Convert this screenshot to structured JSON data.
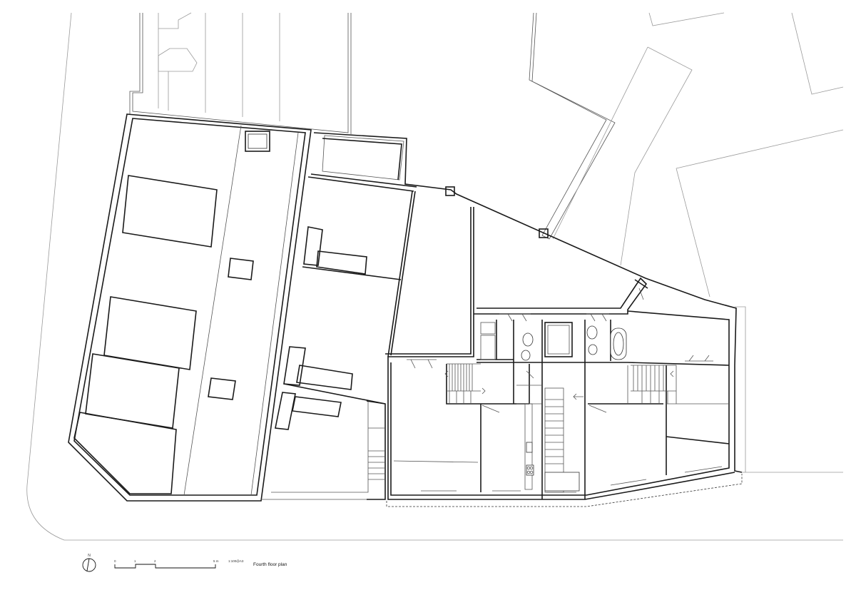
{
  "drawing": {
    "title": "Fourth floor plan",
    "north_label": "N",
    "scale_ticks": [
      "0",
      "1",
      "2",
      "5 m"
    ],
    "scale_note": "1:100@A3"
  }
}
